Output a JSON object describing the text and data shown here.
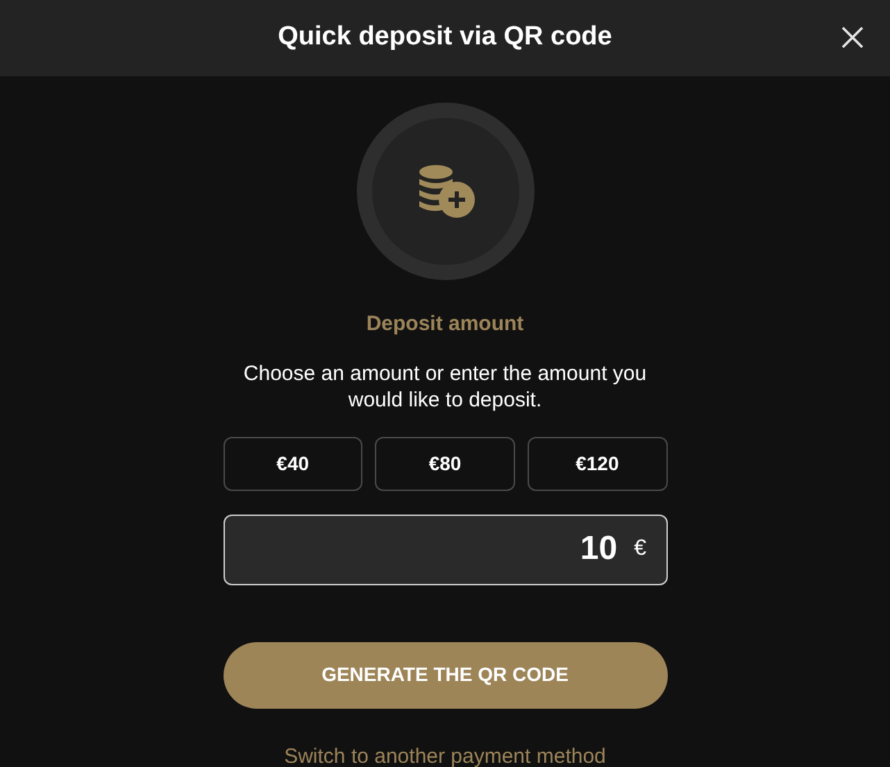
{
  "window": {
    "title": "Quick deposit via QR code"
  },
  "heading": "Deposit amount",
  "instructions": "Choose an amount or enter the amount you would like to deposit.",
  "amounts": [
    {
      "label": "€40",
      "selected": false
    },
    {
      "label": "€80",
      "selected": false
    },
    {
      "label": "€120",
      "selected": false
    }
  ],
  "amount_field": {
    "value": "10",
    "currency": "€"
  },
  "primary_button": "GENERATE THE QR CODE",
  "switch_link": "Switch to another payment method"
}
